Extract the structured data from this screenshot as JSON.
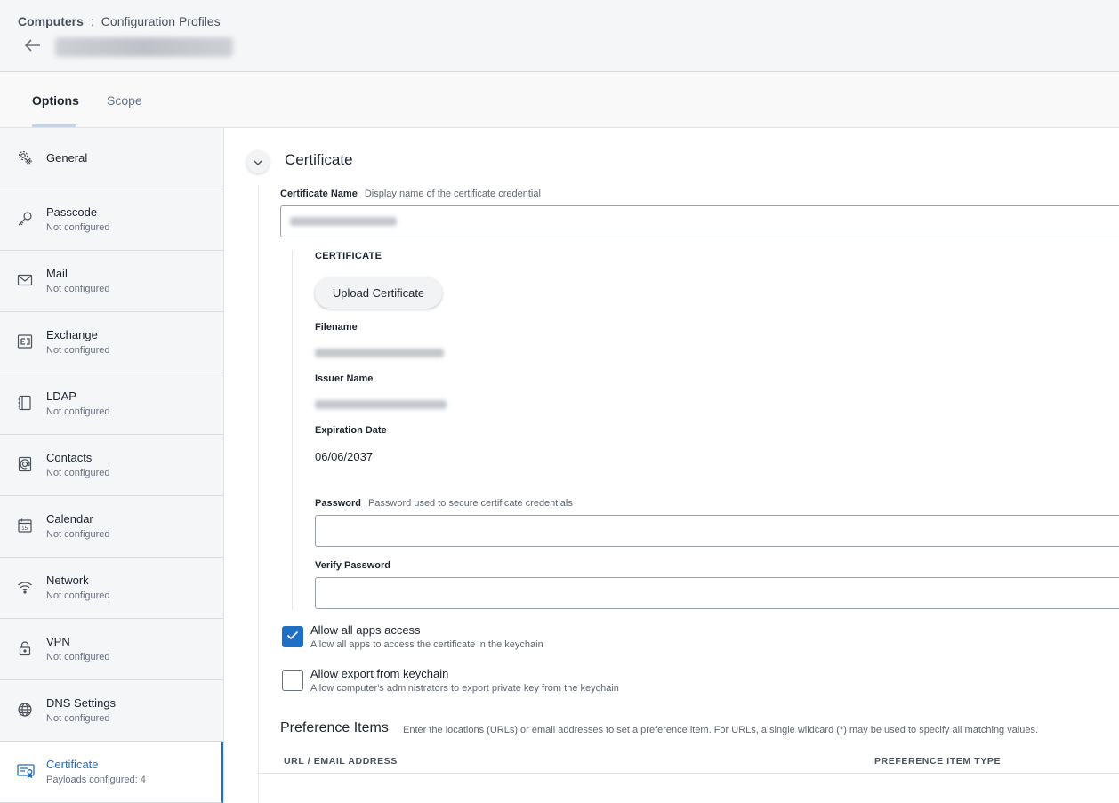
{
  "breadcrumb": {
    "root": "Computers",
    "separator": ":",
    "current": "Configuration Profiles"
  },
  "tabs": [
    {
      "label": "Options"
    },
    {
      "label": "Scope"
    }
  ],
  "sidebar": {
    "items": [
      {
        "label": "General",
        "sub": "",
        "icon": "gear-icon"
      },
      {
        "label": "Passcode",
        "sub": "Not configured",
        "icon": "key-icon"
      },
      {
        "label": "Mail",
        "sub": "Not configured",
        "icon": "envelope-icon"
      },
      {
        "label": "Exchange",
        "sub": "Not configured",
        "icon": "exchange-icon"
      },
      {
        "label": "LDAP",
        "sub": "Not configured",
        "icon": "book-icon"
      },
      {
        "label": "Contacts",
        "sub": "Not configured",
        "icon": "contacts-icon"
      },
      {
        "label": "Calendar",
        "sub": "Not configured",
        "icon": "calendar-icon"
      },
      {
        "label": "Network",
        "sub": "Not configured",
        "icon": "wifi-icon"
      },
      {
        "label": "VPN",
        "sub": "Not configured",
        "icon": "lock-icon"
      },
      {
        "label": "DNS Settings",
        "sub": "Not configured",
        "icon": "globe-icon"
      },
      {
        "label": "Certificate",
        "sub": "Payloads configured: 4",
        "icon": "certificate-icon"
      }
    ]
  },
  "main": {
    "section_title": "Certificate",
    "certificate_name": {
      "label": "Certificate Name",
      "hint": "Display name of the certificate credential"
    },
    "certificate_caps": "CERTIFICATE",
    "upload_button": "Upload Certificate",
    "filename_label": "Filename",
    "issuer_label": "Issuer Name",
    "expiration": {
      "label": "Expiration Date",
      "value": "06/06/2037"
    },
    "password": {
      "label": "Password",
      "hint": "Password used to secure certificate credentials"
    },
    "verify_password": {
      "label": "Verify Password"
    },
    "allow_all_apps": {
      "title": "Allow all apps access",
      "desc": "Allow all apps to access the certificate in the keychain",
      "checked": true
    },
    "allow_export": {
      "title": "Allow export from keychain",
      "desc": "Allow computer's administrators to export private key from the keychain",
      "checked": false
    },
    "preference": {
      "title": "Preference Items",
      "hint": "Enter the locations (URLs) or email addresses to set a preference item. For URLs, a single wildcard (*) may be used to specify all matching values.",
      "columns": [
        "URL / EMAIL ADDRESS",
        "PREFERENCE ITEM TYPE"
      ]
    }
  },
  "colors": {
    "accent": "#1f6fc4",
    "sidebar_bg": "#f5f6f8"
  }
}
